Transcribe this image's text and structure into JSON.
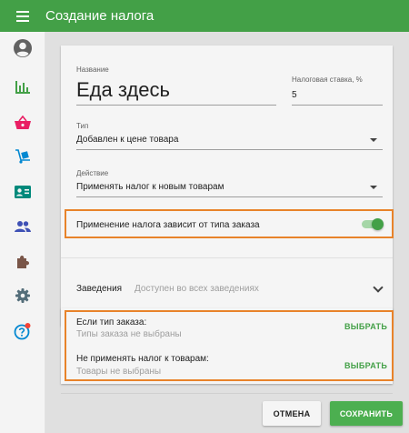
{
  "appbar": {
    "title": "Создание налога",
    "menu_icon": "menu-icon"
  },
  "sidebar": {
    "items": [
      {
        "name": "account",
        "icon": "account-circle-icon"
      },
      {
        "name": "reports",
        "icon": "bar-chart-icon"
      },
      {
        "name": "goods",
        "icon": "basket-icon"
      },
      {
        "name": "inventory",
        "icon": "dolly-icon"
      },
      {
        "name": "employees",
        "icon": "badge-icon"
      },
      {
        "name": "customers",
        "icon": "people-icon"
      },
      {
        "name": "integrations",
        "icon": "puzzle-icon"
      },
      {
        "name": "settings",
        "icon": "gear-icon"
      },
      {
        "name": "help",
        "icon": "help-icon"
      }
    ]
  },
  "form": {
    "name_label": "Название",
    "name_value": "Еда здесь",
    "rate_label": "Налоговая ставка, %",
    "rate_value": "5",
    "type_label": "Тип",
    "type_value": "Добавлен к цене товара",
    "action_label": "Действие",
    "action_value": "Применять налог к новым товарам",
    "toggle_label": "Применение налога зависит от типа заказа",
    "toggle_on": true,
    "places_label": "Заведения",
    "places_value": "Доступен во всех заведениях"
  },
  "conditions": {
    "order_type_title": "Если тип заказа:",
    "order_type_sub": "Типы заказа не выбраны",
    "exclude_title": "Не применять налог к товарам:",
    "exclude_sub": "Товары не выбраны",
    "select_label": "ВЫБРАТЬ"
  },
  "actions": {
    "cancel": "ОТМЕНА",
    "save": "СОХРАНИТЬ"
  },
  "colors": {
    "primary": "#43a047",
    "highlight": "#e8832a",
    "notification_dot": "#f44336"
  }
}
